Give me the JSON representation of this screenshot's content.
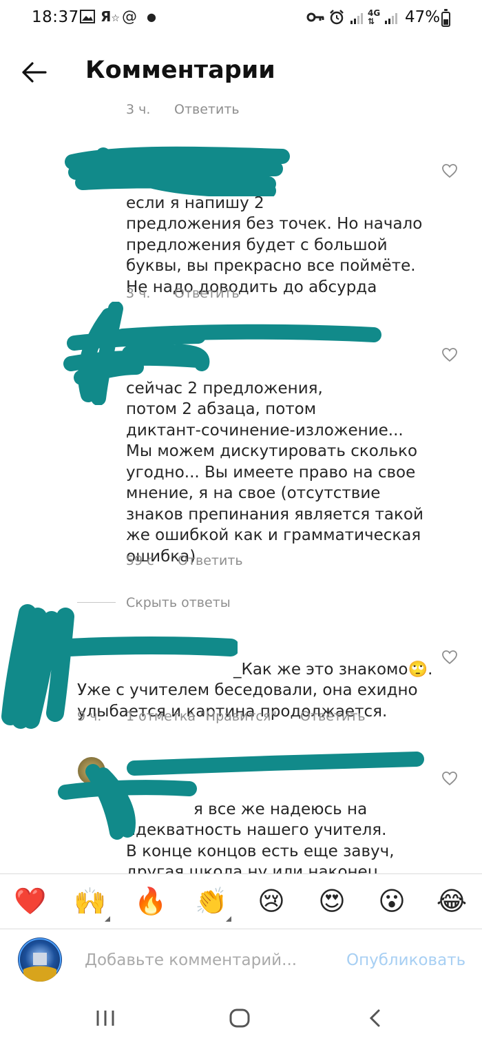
{
  "status_bar": {
    "time": "18:37",
    "battery": "47%",
    "battery_level": 0.47
  },
  "header": {
    "title": "Комментарии"
  },
  "comments": [
    {
      "time": "3 ч.",
      "reply": "Ответить"
    },
    {
      "text": "если я напишу 2\nпредложения без точек. Но начало\nпредложения будет с большой\nбуквы, вы прекрасно все поймёте.\nНе надо доводить до абсурда",
      "time": "3 ч.",
      "reply": "Ответить"
    },
    {
      "text": "сейчас 2 предложения,\nпотом 2 абзаца, потом\nдиктант-сочинение-изложение...\nМы можем дискутировать сколько\nугодно... Вы имеете право на свое\nмнение, я на свое (отсутствие\nзнаков препинания является такой\nже ошибкой как и грамматическая\nошибка)",
      "time": "59 с",
      "reply": "Ответить"
    }
  ],
  "hide_replies": "Скрыть ответы",
  "reply_comment": {
    "text": "_Как же это знакомо🙄.\nУже с учителем беседовали, она ехидно\nулыбается и картина продолжается.",
    "time": "9 ч.",
    "likes": "1 отметка \"Нравится\"",
    "reply": "Ответить"
  },
  "last_comment": {
    "text": "я все же надеюсь на\nадекватность нашего учителя.\nВ конце концов есть еще завуч,\nдругая школа ну или наконец\nонлайн-обучение"
  },
  "emoji_bar": [
    "❤️",
    "🙌",
    "🔥",
    "👏",
    "😢",
    "😍",
    "😮",
    "😂"
  ],
  "input": {
    "placeholder": "Добавьте комментарий...",
    "publish": "Опубликовать"
  },
  "nav": {
    "icons": [
      "recent-apps-icon",
      "home-icon",
      "back-icon"
    ]
  },
  "colors": {
    "scribble": "#118a8a",
    "meta": "#8e8e8e",
    "publish": "#a7cff3"
  }
}
